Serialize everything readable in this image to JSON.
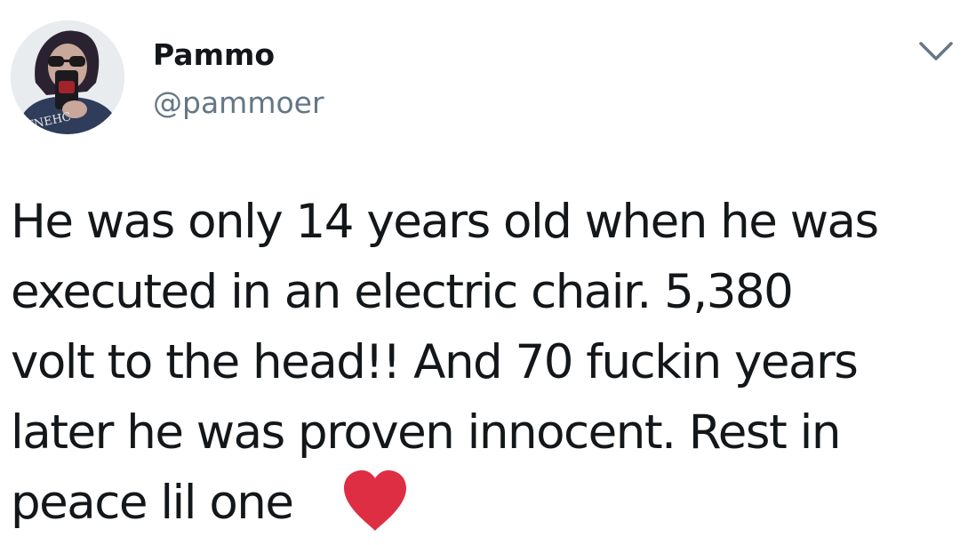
{
  "user": {
    "display_name": "Pammo",
    "handle": "@pammoer",
    "avatar_icon": "profile-photo",
    "avatar_shirt_text": "TNEHC"
  },
  "menu": {
    "caret_icon": "chevron-down-icon"
  },
  "tweet": {
    "lines": [
      "He was only 14 years old when he was",
      "executed in an electric chair. 5,380",
      "volt to the head!! And 70 fuckin years",
      "later he was proven innocent. Rest in",
      "peace lil one"
    ],
    "emoji": "heart-emoji"
  },
  "colors": {
    "text": "#14171a",
    "handle": "#657786",
    "heart": "#e0245e",
    "caret": "#657786"
  }
}
